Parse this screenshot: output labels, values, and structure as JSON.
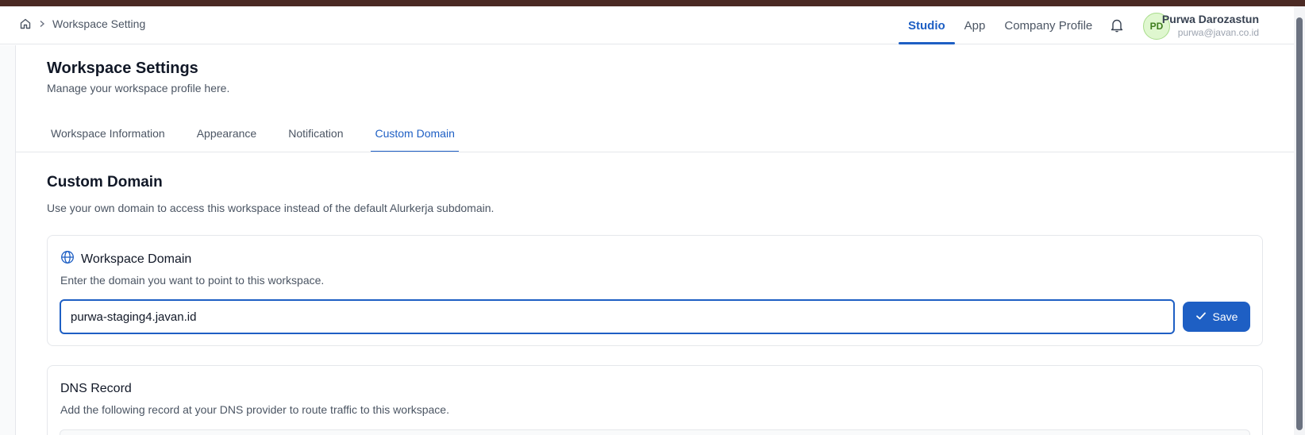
{
  "topbar": {
    "breadcrumb_current": "Workspace Setting",
    "nav": [
      "Studio",
      "App",
      "Company Profile"
    ],
    "active_nav": "Studio",
    "user": {
      "initials": "PD",
      "name": "Purwa Darozastun",
      "email": "purwa@javan.co.id"
    }
  },
  "page": {
    "title": "Workspace Settings",
    "subtitle": "Manage your workspace profile here.",
    "tabs": [
      "Workspace Information",
      "Appearance",
      "Notification",
      "Custom Domain"
    ],
    "active_tab": "Custom Domain"
  },
  "section": {
    "title": "Custom Domain",
    "description": "Use your own domain to access this workspace instead of the default Alurkerja subdomain."
  },
  "domain_card": {
    "title": "Workspace Domain",
    "description": "Enter the domain you want to point to this workspace.",
    "input_value": "purwa-staging4.javan.id",
    "save_label": "Save"
  },
  "dns_card": {
    "title": "DNS Record",
    "description": "Add the following record at your DNS provider to route traffic to this workspace."
  },
  "colors": {
    "accent": "#1e5fc4",
    "avatar_bg": "#dff7cf"
  },
  "icons": [
    "home-icon",
    "chevron-right-icon",
    "bell-icon",
    "globe-icon",
    "check-icon"
  ]
}
